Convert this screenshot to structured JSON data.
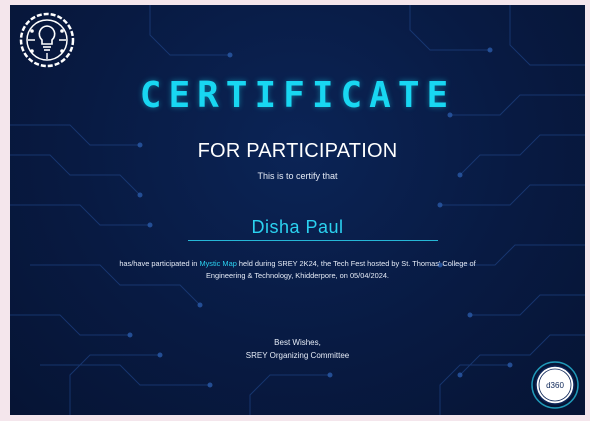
{
  "certificate": {
    "title": "CERTIFICATE",
    "subtitle": "FOR PARTICIPATION",
    "certify_line": "This is to certify that",
    "recipient_name": "Disha Paul",
    "body_prefix": "has/have participated in ",
    "event_name": "Mystic Map",
    "body_suffix": " held during SREY 2K24, the Tech Fest hosted by St. Thomas' College of Engineering & Technology, Khidderpore, on 05/04/2024.",
    "closing": "Best Wishes,",
    "signatory": "SREY Organizing Committee",
    "badge_text": "d360"
  },
  "colors": {
    "background": "#081a42",
    "accent": "#18d7f2",
    "text": "#ffffff",
    "frame": "#f4e6ec"
  },
  "icons": {
    "logo": "lightbulb-gear-logo-icon",
    "badge": "d360-badge-icon"
  }
}
